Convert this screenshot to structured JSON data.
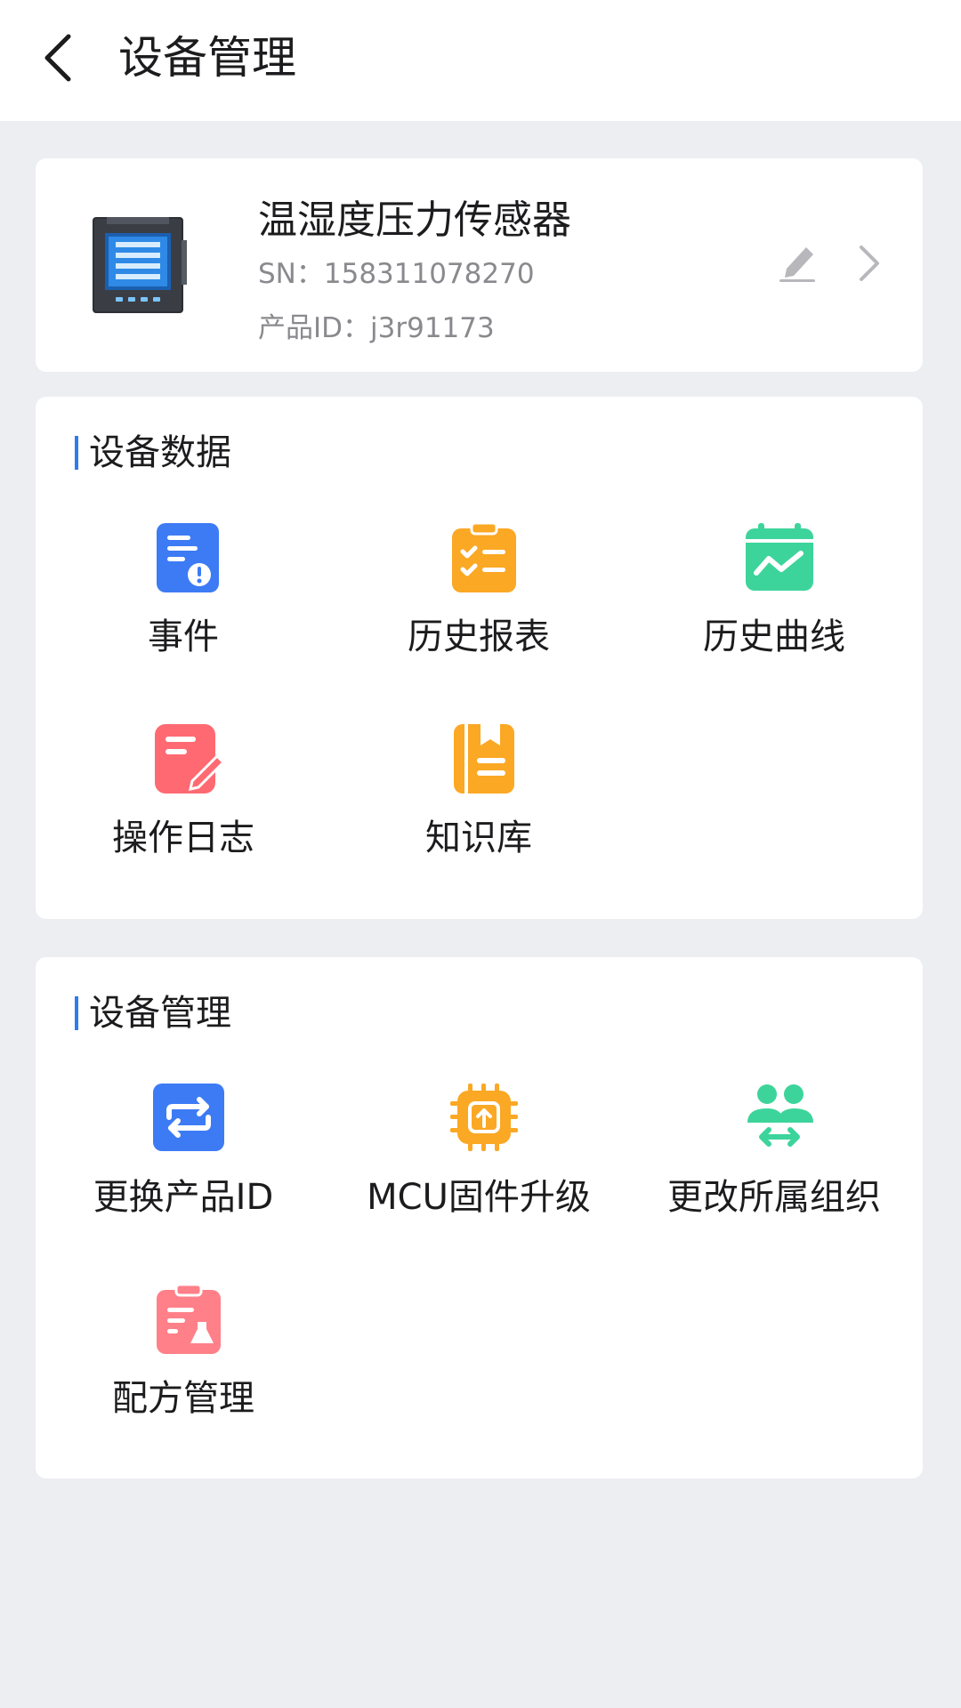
{
  "header": {
    "title": "设备管理"
  },
  "device": {
    "name": "温湿度压力传感器",
    "sn": "SN：158311078270",
    "product_id": "产品ID：j3r91173"
  },
  "data_section": {
    "title": "设备数据",
    "items": [
      {
        "label": "事件",
        "icon": "event-alert-icon",
        "color": "#3D7BF5"
      },
      {
        "label": "历史报表",
        "icon": "report-checklist-icon",
        "color": "#FBA824"
      },
      {
        "label": "历史曲线",
        "icon": "calendar-curve-icon",
        "color": "#3DD49C"
      },
      {
        "label": "操作日志",
        "icon": "note-pen-icon",
        "color": "#FF6A72"
      },
      {
        "label": "知识库",
        "icon": "book-bookmark-icon",
        "color": "#FBA824"
      }
    ]
  },
  "mgmt_section": {
    "title": "设备管理",
    "items": [
      {
        "label": "更换产品ID",
        "icon": "swap-arrows-icon",
        "color": "#3D7BF5"
      },
      {
        "label": "MCU固件升级",
        "icon": "chip-upgrade-icon",
        "color": "#FBA824"
      },
      {
        "label": "更改所属组织",
        "icon": "group-transfer-icon",
        "color": "#3DD49C"
      },
      {
        "label": "配方管理",
        "icon": "clipboard-flask-icon",
        "color": "#FF8088"
      }
    ]
  }
}
